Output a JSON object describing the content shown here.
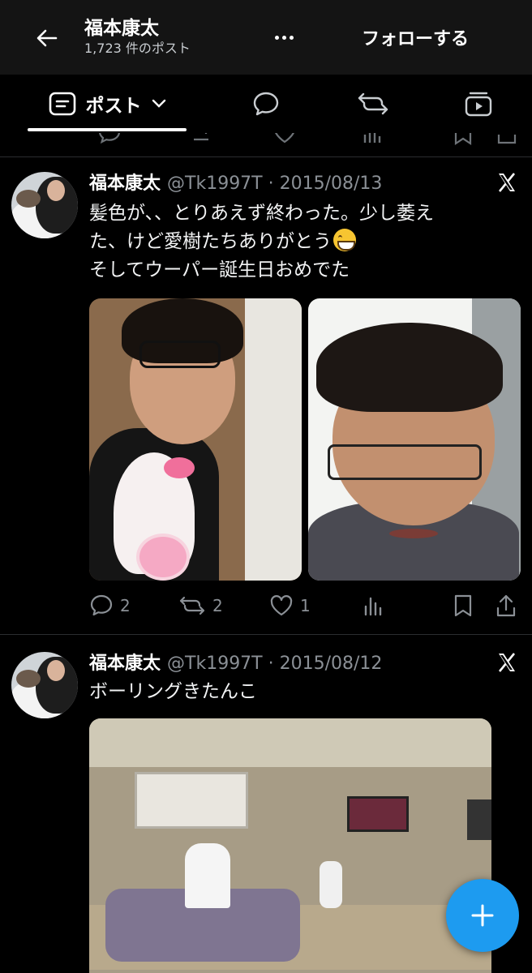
{
  "header": {
    "profile_name": "福本康太",
    "post_count": "1,723 件のポスト",
    "follow_label": "フォローする"
  },
  "tabs": {
    "posts_label": "ポスト"
  },
  "posts": [
    {
      "name": "福本康太",
      "handle_date": "@Tk1997T · 2015/08/13",
      "text_line1": "髪色が、、とりあえず終わった。少し萎え",
      "text_line2": "た、けど愛樹たちありがとう",
      "text_line3": "そしてウーパー誕生日おめでた",
      "emoji": "grinning-face-emoji",
      "replies": "2",
      "reposts": "2",
      "likes": "1"
    },
    {
      "name": "福本康太",
      "handle_date": "@Tk1997T · 2015/08/12",
      "text_line1": "ボーリングきたんこ"
    }
  ],
  "colors": {
    "background": "#000000",
    "header_bg": "#141414",
    "accent": "#1d9bf0",
    "secondary_text": "#8b9096"
  }
}
